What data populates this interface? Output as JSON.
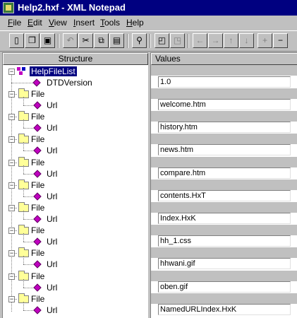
{
  "window": {
    "title": "Help2.hxf - XML Notepad"
  },
  "menu": [
    "File",
    "Edit",
    "View",
    "Insert",
    "Tools",
    "Help"
  ],
  "toolbar": {
    "buttons": [
      {
        "name": "new-icon",
        "glyph": "▯"
      },
      {
        "name": "open-icon",
        "glyph": "❐"
      },
      {
        "name": "save-icon",
        "glyph": "▣"
      },
      {
        "name": "undo-icon",
        "glyph": "↶"
      },
      {
        "name": "cut-icon",
        "glyph": "✂"
      },
      {
        "name": "copy-icon",
        "glyph": "⧉"
      },
      {
        "name": "paste-icon",
        "glyph": "▤"
      },
      {
        "name": "find-icon",
        "glyph": "⚲"
      },
      {
        "name": "insert-child-icon",
        "glyph": "◰"
      },
      {
        "name": "insert-sibling-icon",
        "glyph": "◳"
      },
      {
        "name": "move-left-icon",
        "glyph": "←"
      },
      {
        "name": "move-right-icon",
        "glyph": "→"
      },
      {
        "name": "move-up-icon",
        "glyph": "↑"
      },
      {
        "name": "move-down-icon",
        "glyph": "↓"
      },
      {
        "name": "expand-icon",
        "glyph": "+"
      },
      {
        "name": "collapse-icon",
        "glyph": "−"
      }
    ]
  },
  "structure": {
    "header": "Structure",
    "root": "HelpFileList",
    "dtd": "DTDVersion",
    "file_label": "File",
    "url_label": "Url"
  },
  "values": {
    "header": "Values",
    "dtd_version": "1.0",
    "urls": [
      "welcome.htm",
      "history.htm",
      "news.htm",
      "compare.htm",
      "contents.HxT",
      "Index.HxK",
      "hh_1.css",
      "hhwani.gif",
      "oben.gif",
      "NamedURLIndex.HxK"
    ]
  },
  "colors": {
    "titlebar": "#000080",
    "selection": "#000080",
    "element_icon": "#c000c0",
    "folder": "#ffff99"
  }
}
